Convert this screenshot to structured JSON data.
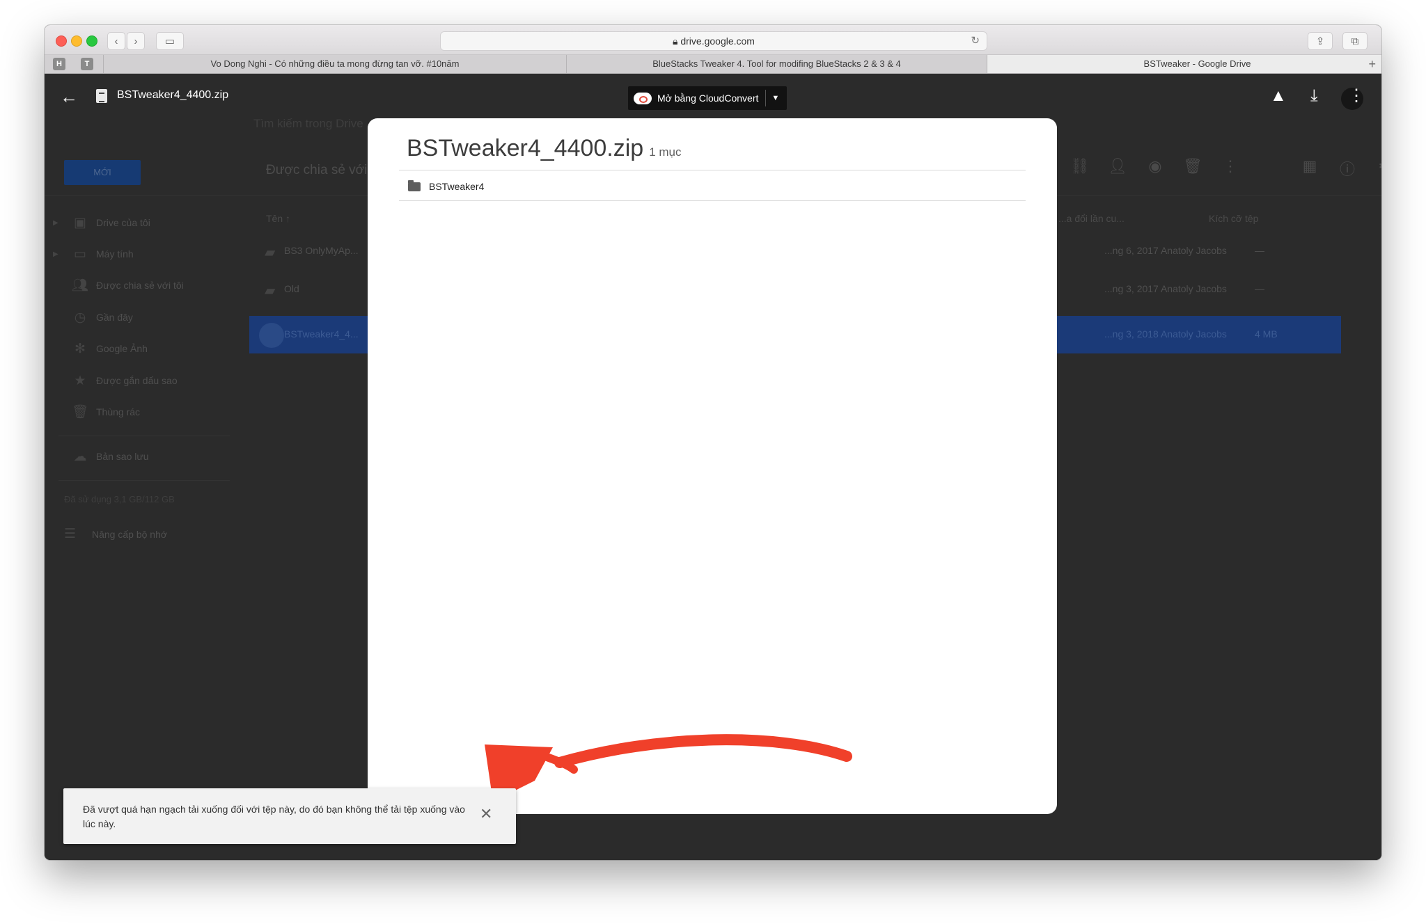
{
  "browser": {
    "url": "drive.google.com",
    "tabs": [
      {
        "label": "Vo Dong Nghi - Có những điều ta mong đừng tan vỡ. #10năm",
        "active": false
      },
      {
        "label": "BlueStacks Tweaker 4. Tool for modifing BlueStacks 2 & 3 & 4",
        "active": false
      },
      {
        "label": "BSTweaker - Google Drive",
        "active": true
      }
    ],
    "pinned_tabs": [
      "H",
      "T"
    ]
  },
  "viewer_header": {
    "file_name": "BSTweaker4_4400.zip",
    "open_with_label": "Mở bằng CloudConvert",
    "icons": [
      "back-arrow-icon",
      "zip-file-icon",
      "cloudconvert-icon",
      "chevron-down-icon",
      "add-to-drive-icon",
      "download-icon",
      "more-vert-icon",
      "avatar"
    ]
  },
  "drive_background": {
    "search_placeholder": "Tìm kiếm trong Drive",
    "new_button": "MỚI",
    "section_title": "Được chia sẻ với tôi",
    "sidebar": [
      {
        "label": "Drive của tôi",
        "icon": "my-drive-icon"
      },
      {
        "label": "Máy tính",
        "icon": "computer-icon"
      },
      {
        "label": "Được chia sẻ với tôi",
        "icon": "people-icon"
      },
      {
        "label": "Gần đây",
        "icon": "clock-icon"
      },
      {
        "label": "Google Ảnh",
        "icon": "pinwheel-icon"
      },
      {
        "label": "Được gắn dấu sao",
        "icon": "star-icon"
      },
      {
        "label": "Thùng rác",
        "icon": "trash-icon"
      },
      {
        "label": "Bản sao lưu",
        "icon": "cloud-icon"
      }
    ],
    "storage_text": "Đã sử dụng 3,1 GB/112 GB",
    "upgrade_label": "Nâng cấp bộ nhớ",
    "columns": {
      "name": "Tên",
      "modified": "...a đổi lần cu...",
      "size": "Kích cỡ tệp"
    },
    "rows": [
      {
        "name": "BS3 OnlyMyAp...",
        "modified": "...ng 6, 2017 Anatoly Jacobs",
        "size": "—",
        "selected": false
      },
      {
        "name": "Old",
        "modified": "...ng 3, 2017 Anatoly Jacobs",
        "size": "—",
        "selected": false
      },
      {
        "name": "BSTweaker4_4...",
        "modified": "...ng 3, 2018 Anatoly Jacobs",
        "size": "4 MB",
        "selected": true
      }
    ]
  },
  "modal": {
    "title": "BSTweaker4_4400.zip",
    "count": "1 mục",
    "items": [
      {
        "name": "BSTweaker4",
        "icon": "folder-icon"
      }
    ]
  },
  "snackbar": {
    "message": "Đã vượt quá hạn ngạch tải xuống đối với tệp này, do đó bạn không thể tải tệp xuống vào lúc này.",
    "close_icon": "close-icon"
  },
  "colors": {
    "overlay_bg": "#2b2b2b",
    "selected_row": "#1b3a78",
    "annotation_arrow": "#f0402a"
  }
}
